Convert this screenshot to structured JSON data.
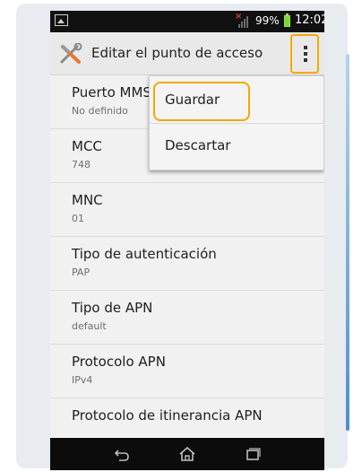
{
  "status_bar": {
    "battery_percent": "99%",
    "time": "12:02",
    "icons": [
      "image-thumbnail-icon",
      "no-signal-icon",
      "battery-icon"
    ],
    "colors": {
      "no_signal": "#e53935",
      "battery": "#7cd63b"
    }
  },
  "action_bar": {
    "title": "Editar el punto de acceso",
    "icon": "tools-icon",
    "overflow_icon": "overflow-menu-icon"
  },
  "menu": {
    "items": [
      {
        "label": "Guardar"
      },
      {
        "label": "Descartar"
      }
    ],
    "highlight_color": "#f5a800"
  },
  "settings": {
    "items": [
      {
        "title": "Puerto MMS",
        "value": "No definido"
      },
      {
        "title": "MCC",
        "value": "748"
      },
      {
        "title": "MNC",
        "value": "01"
      },
      {
        "title": "Tipo de autenticación",
        "value": "PAP"
      },
      {
        "title": "Tipo de APN",
        "value": "default"
      },
      {
        "title": "Protocolo APN",
        "value": "IPv4"
      },
      {
        "title": "Protocolo de itinerancia APN",
        "value": ""
      }
    ]
  },
  "nav_bar": {
    "icons": [
      "back-icon",
      "home-icon",
      "recent-apps-icon"
    ]
  }
}
